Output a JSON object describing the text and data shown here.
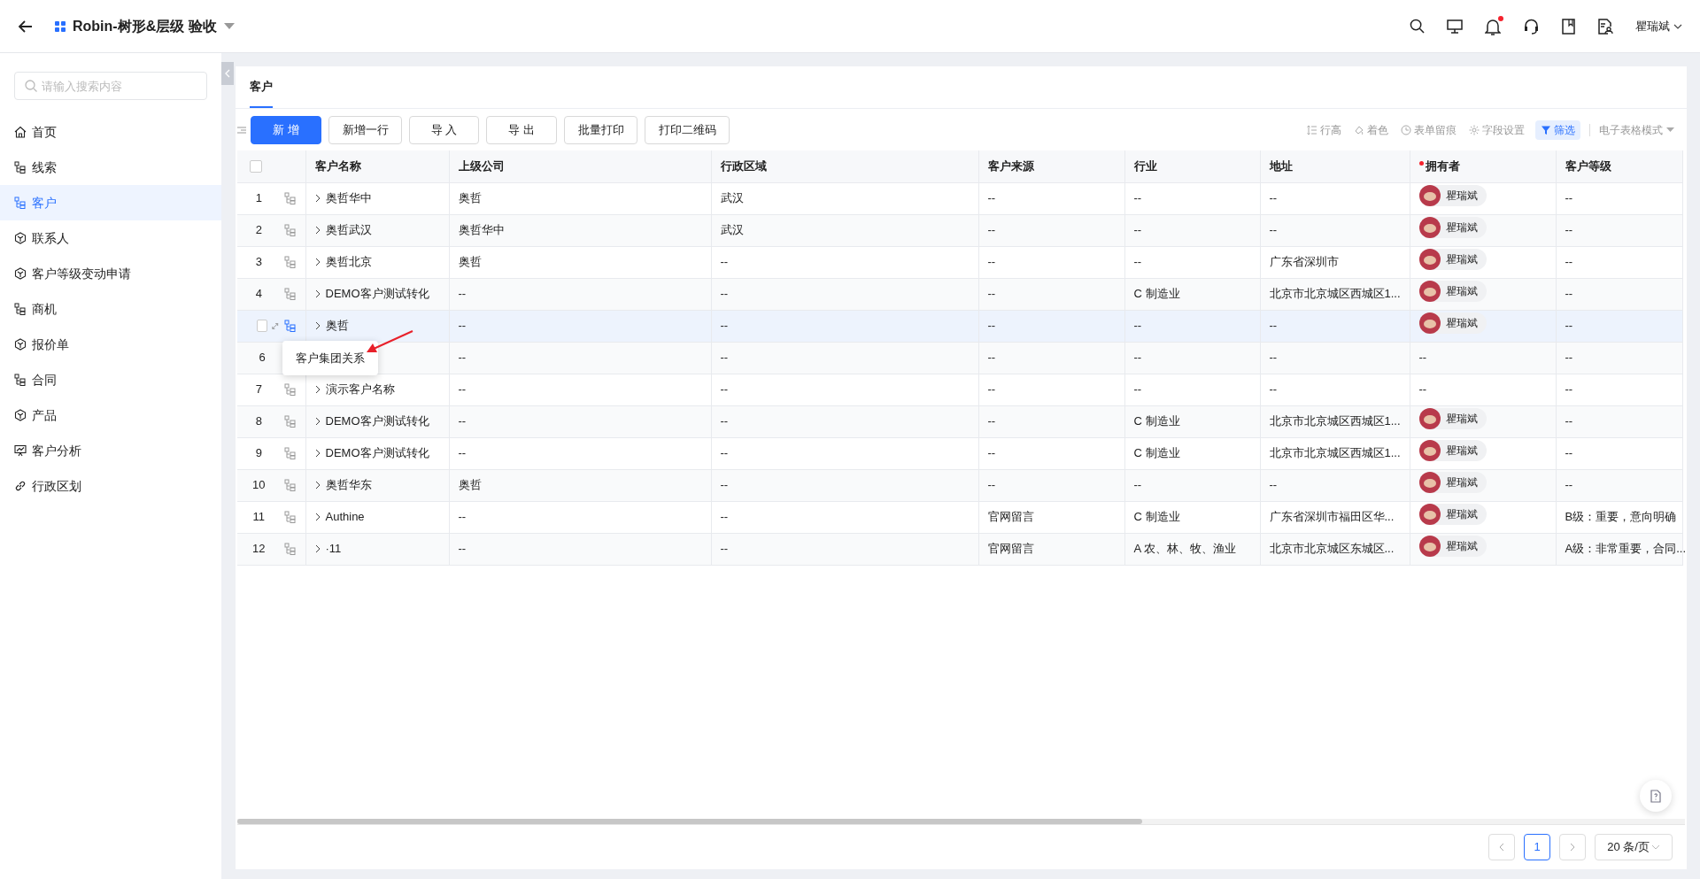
{
  "topbar": {
    "title": "Robin-树形&层级 验收",
    "user": "瞿瑞斌",
    "notification": true
  },
  "sidebar": {
    "search_placeholder": "请输入搜索内容",
    "items": [
      {
        "label": "首页",
        "kind": "home",
        "selected": false
      },
      {
        "label": "线索",
        "kind": "tree",
        "selected": false
      },
      {
        "label": "客户",
        "kind": "tree",
        "selected": true
      },
      {
        "label": "联系人",
        "kind": "cube",
        "selected": false
      },
      {
        "label": "客户等级变动申请",
        "kind": "cube",
        "selected": false
      },
      {
        "label": "商机",
        "kind": "tree",
        "selected": false
      },
      {
        "label": "报价单",
        "kind": "cube",
        "selected": false
      },
      {
        "label": "合同",
        "kind": "tree",
        "selected": false
      },
      {
        "label": "产品",
        "kind": "cube",
        "selected": false
      },
      {
        "label": "客户分析",
        "kind": "chart",
        "selected": false
      },
      {
        "label": "行政区划",
        "kind": "link",
        "selected": false
      }
    ]
  },
  "tabs": [
    {
      "label": "客户",
      "selected": true
    }
  ],
  "toolbar": {
    "buttons": [
      {
        "label": "新 增",
        "primary": true
      },
      {
        "label": "新增一行",
        "primary": false
      },
      {
        "label": "导 入",
        "primary": false
      },
      {
        "label": "导 出",
        "primary": false
      },
      {
        "label": "批量打印",
        "primary": false
      },
      {
        "label": "打印二维码",
        "primary": false
      }
    ],
    "tools": [
      {
        "label": "行高",
        "kind": "row-height",
        "active": false
      },
      {
        "label": "着色",
        "kind": "paint",
        "active": false
      },
      {
        "label": "表单留痕",
        "kind": "history",
        "active": false
      },
      {
        "label": "字段设置",
        "kind": "gear",
        "active": false
      },
      {
        "label": "筛选",
        "kind": "filter",
        "active": true
      }
    ],
    "mode": "电子表格模式"
  },
  "table": {
    "columns": [
      {
        "label": "客户名称",
        "required": false
      },
      {
        "label": "上级公司",
        "required": false
      },
      {
        "label": "行政区域",
        "required": false
      },
      {
        "label": "客户来源",
        "required": false
      },
      {
        "label": "行业",
        "required": false
      },
      {
        "label": "地址",
        "required": false
      },
      {
        "label": "拥有者",
        "required": true
      },
      {
        "label": "客户等级",
        "required": false
      }
    ],
    "select_all_checked": false,
    "rows": [
      {
        "index": "1",
        "hovered": false,
        "cells": [
          "奥哲华中",
          "奥哲",
          "武汉",
          "--",
          "--",
          "--",
          "瞿瑞斌",
          "--"
        ],
        "avatar": true
      },
      {
        "index": "2",
        "hovered": false,
        "cells": [
          "奥哲武汉",
          "奥哲华中",
          "武汉",
          "--",
          "--",
          "--",
          "瞿瑞斌",
          "--"
        ],
        "avatar": true
      },
      {
        "index": "3",
        "hovered": false,
        "cells": [
          "奥哲北京",
          "奥哲",
          "--",
          "--",
          "--",
          "广东省深圳市",
          "瞿瑞斌",
          "--"
        ],
        "avatar": true
      },
      {
        "index": "4",
        "hovered": false,
        "cells": [
          "DEMO客户测试转化",
          "--",
          "--",
          "--",
          "C 制造业",
          "北京市北京城区西城区1...",
          "瞿瑞斌",
          "--"
        ],
        "avatar": true
      },
      {
        "hovered": true,
        "checked": false,
        "cells": [
          "奥哲",
          "--",
          "--",
          "--",
          "--",
          "--",
          "瞿瑞斌",
          "--"
        ],
        "avatar": true
      },
      {
        "index": "6",
        "hovered": false,
        "cells": [
          "",
          "--",
          "--",
          "--",
          "--",
          "--",
          "--",
          "--"
        ],
        "avatar": false
      },
      {
        "index": "7",
        "hovered": false,
        "cells": [
          "演示客户名称",
          "--",
          "--",
          "--",
          "--",
          "--",
          "--",
          "--"
        ],
        "avatar": false
      },
      {
        "index": "8",
        "hovered": false,
        "cells": [
          "DEMO客户测试转化",
          "--",
          "--",
          "--",
          "C 制造业",
          "北京市北京城区西城区1...",
          "瞿瑞斌",
          "--"
        ],
        "avatar": true
      },
      {
        "index": "9",
        "hovered": false,
        "cells": [
          "DEMO客户测试转化",
          "--",
          "--",
          "--",
          "C 制造业",
          "北京市北京城区西城区1...",
          "瞿瑞斌",
          "--"
        ],
        "avatar": true
      },
      {
        "index": "10",
        "hovered": false,
        "cells": [
          "奥哲华东",
          "奥哲",
          "--",
          "--",
          "--",
          "--",
          "瞿瑞斌",
          "--"
        ],
        "avatar": true
      },
      {
        "index": "11",
        "hovered": false,
        "cells": [
          "Authine",
          "--",
          "--",
          "官网留言",
          "C 制造业",
          "广东省深圳市福田区华...",
          "瞿瑞斌",
          "B级：重要，意向明确"
        ],
        "avatar": true
      },
      {
        "index": "12",
        "hovered": false,
        "cells": [
          "·11",
          "--",
          "--",
          "官网留言",
          "A 农、林、牧、渔业",
          "北京市北京城区东城区...",
          "瞿瑞斌",
          "A级：非常重要，合同..."
        ],
        "avatar": true
      }
    ]
  },
  "tooltip": {
    "text": "客户集团关系"
  },
  "pagination": {
    "page": "1",
    "page_size": "20 条/页"
  }
}
